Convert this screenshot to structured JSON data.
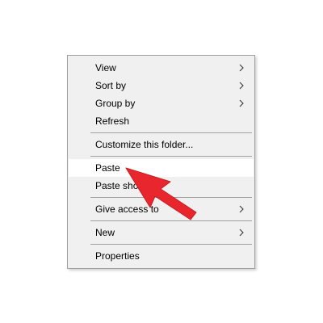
{
  "context_menu": {
    "items": [
      {
        "label": "View",
        "has_submenu": true
      },
      {
        "label": "Sort by",
        "has_submenu": true
      },
      {
        "label": "Group by",
        "has_submenu": true
      },
      {
        "label": "Refresh",
        "has_submenu": false
      },
      {
        "label": "Customize this folder...",
        "has_submenu": false
      },
      {
        "label": "Paste",
        "has_submenu": false,
        "highlighted": true
      },
      {
        "label": "Paste shortcut",
        "has_submenu": false
      },
      {
        "label": "Give access to",
        "has_submenu": true
      },
      {
        "label": "New",
        "has_submenu": true
      },
      {
        "label": "Properties",
        "has_submenu": false
      }
    ]
  },
  "colors": {
    "menu_background": "#f0f0f0",
    "menu_border": "#a0a0a0",
    "highlight_background": "#ffffff",
    "annotation_arrow": "#e8262d"
  },
  "icons": {
    "submenu": "chevron-right-icon",
    "annotation": "red-arrow-icon"
  }
}
